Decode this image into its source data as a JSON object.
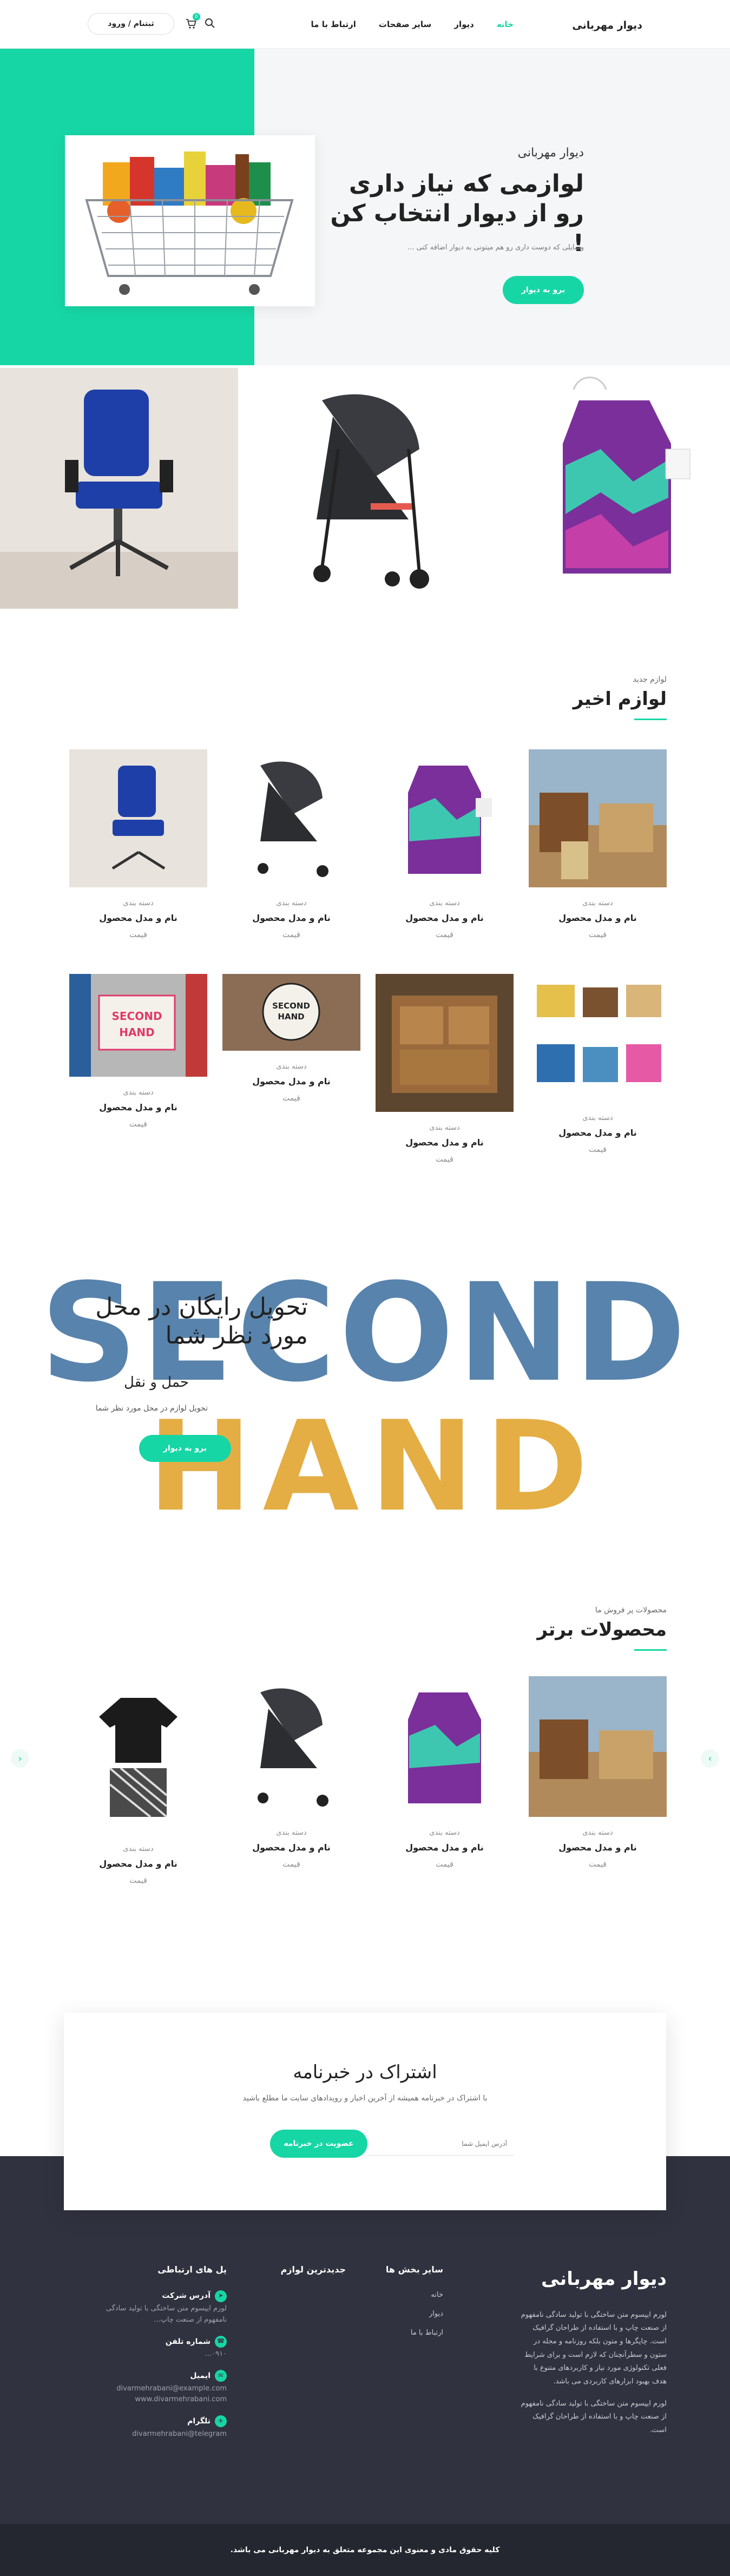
{
  "header": {
    "logo": "دیوار مهربانی",
    "nav": [
      "خانه",
      "دیوار",
      "سایر صفحات",
      "ارتباط با ما"
    ],
    "login_label": "ثبتنام / ورود",
    "cart_count": "0"
  },
  "hero": {
    "kicker": "دیوار مهربانی",
    "title": "لوازمی که نیاز داری رو از دیوار انتخاب کن !",
    "description": "وسایلی که دوست داری رو هم میتونی به دیوار اضافه کنی ...",
    "button": "برو به دیوار"
  },
  "recent": {
    "kicker": "لوازم جدید",
    "title": "لوازم اخیر",
    "products": [
      {
        "category": "دسته بندی",
        "name": "نام و مدل محصول",
        "price": "قیمت"
      },
      {
        "category": "دسته بندی",
        "name": "نام و مدل محصول",
        "price": "قیمت"
      },
      {
        "category": "دسته بندی",
        "name": "نام و مدل محصول",
        "price": "قیمت"
      },
      {
        "category": "دسته بندی",
        "name": "نام و مدل محصول",
        "price": "قیمت"
      },
      {
        "category": "دسته بندی",
        "name": "نام و مدل محصول",
        "price": "قیمت"
      },
      {
        "category": "دسته بندی",
        "name": "نام و مدل محصول",
        "price": "قیمت"
      },
      {
        "category": "دسته بندی",
        "name": "نام و مدل محصول",
        "price": "قیمت"
      },
      {
        "category": "دسته بندی",
        "name": "نام و مدل محصول",
        "price": "قیمت"
      }
    ]
  },
  "delivery": {
    "title": "تحویل رایگان در محل مورد نظر شما",
    "subtitle": "حمل و نقل",
    "description": "تحویل لوازم در محل مورد نظر شما",
    "button": "برو به دیوار",
    "big_word_1": "SECOND",
    "big_word_2": "HAND"
  },
  "bestsellers": {
    "kicker": "محصولات پر فروش ما",
    "title": "محصولات برتر",
    "products": [
      {
        "category": "دسته بندی",
        "name": "نام و مدل محصول",
        "price": "قیمت"
      },
      {
        "category": "دسته بندی",
        "name": "نام و مدل محصول",
        "price": "قیمت"
      },
      {
        "category": "دسته بندی",
        "name": "نام و مدل محصول",
        "price": "قیمت"
      },
      {
        "category": "دسته بندی",
        "name": "نام و مدل محصول",
        "price": "قیمت"
      }
    ],
    "prev": "‹",
    "next": "›"
  },
  "newsletter": {
    "title": "اشتراک در خبرنامه",
    "description": "با اشتراک در خبرنامه همیشه از آخرین اخبار و رویدادهای سایت ما مطلع باشید",
    "placeholder": "آدرس ایمیل شما",
    "button": "عضویت در خبرنامه"
  },
  "footer": {
    "brand": "دیوار مهربانی",
    "about_1": "لورم ایپسوم متن ساختگی با تولید سادگی نامفهوم از صنعت چاپ و با استفاده از طراحان گرافیک است. چاپگرها و متون بلکه روزنامه و مجله در ستون و سطرآنچنان که لازم است و برای شرایط فعلی تکنولوژی مورد نیاز و کاربردهای متنوع با هدف بهبود ابزارهای کاربردی می باشد.",
    "about_2": "لورم ایپسوم متن ساختگی با تولید سادگی نامفهوم از صنعت چاپ و با استفاده از طراحان گرافیک است.",
    "col2_title": "سایر بخش ها",
    "col2_links": [
      "خانه",
      "دیوار",
      "ارتباط با ما"
    ],
    "col3_title": "جدیدترین لوازم",
    "col4_title": "پل های ارتباطی",
    "contacts": [
      {
        "label": "آدرس شرکت",
        "value": "لورم ایپسوم متن ساختگی با تولید سادگی نامفهوم از صنعت چاپ..."
      },
      {
        "label": "شماره تلفن",
        "value": "۰۹۱۰..."
      },
      {
        "label": "ایمیل",
        "value": "divarmehrabani@example.com\nwww.divarmehrabani.com"
      },
      {
        "label": "تلگرام",
        "value": "divarmehrabani@telegram"
      }
    ],
    "copyright": "کلیه حقوق مادی و معنوی این مجموعه متعلق به دیوار مهربانی می باشد."
  },
  "colors": {
    "accent": "#17d6a5",
    "dark": "#30333f",
    "darker": "#24272f"
  }
}
